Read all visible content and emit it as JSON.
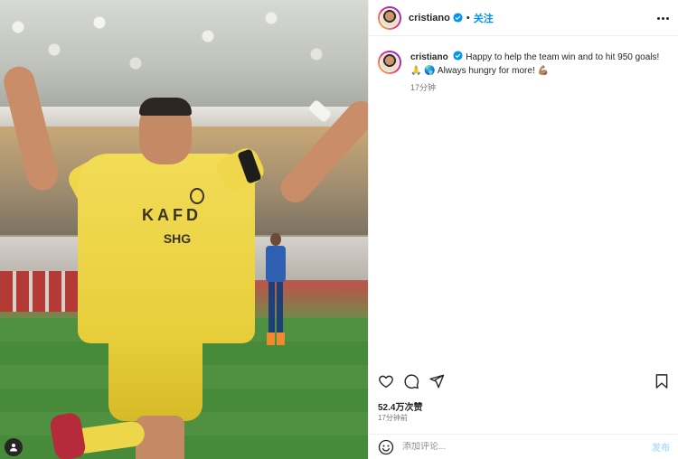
{
  "post": {
    "username": "cristiano",
    "follow_label": "关注",
    "dot": "•",
    "caption_text": "Happy to help the team win and to hit 950 goals! 🙏 🌎 Always hungry for more! 💪🏽",
    "caption_time": "17分钟",
    "likes": "52.4万次赞",
    "posted_time": "17分钟前",
    "comment_placeholder": "添加评论...",
    "post_label": "发布"
  },
  "media": {
    "jersey_sponsor_line1": "KAFD",
    "jersey_sponsor_line2": "SHG"
  },
  "icons": {
    "like": "heart-icon",
    "comment": "comment-icon",
    "share": "share-icon",
    "save": "bookmark-icon",
    "emoji": "emoji-icon",
    "more": "more-icon",
    "verified": "verified-badge-icon",
    "user_tag": "user-tag-icon"
  },
  "colors": {
    "accent_blue": "#0095f6",
    "post_disabled": "#b2dffc",
    "text": "#262626",
    "muted": "#737373"
  }
}
